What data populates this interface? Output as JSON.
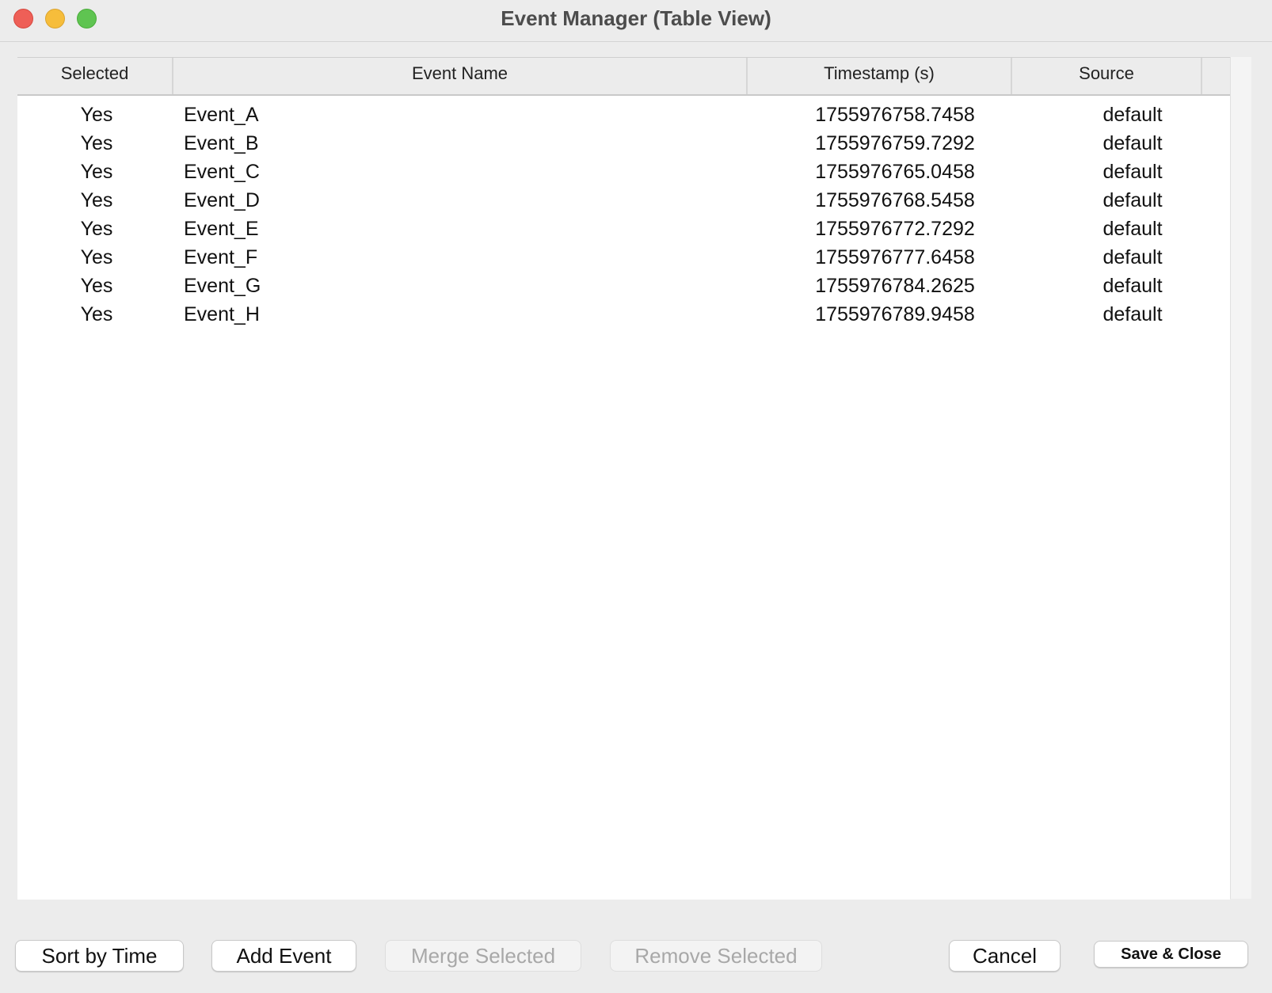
{
  "window": {
    "title": "Event Manager (Table View)"
  },
  "table": {
    "headers": [
      "Selected",
      "Event Name",
      "Timestamp (s)",
      "Source"
    ],
    "rows": [
      {
        "selected": "Yes",
        "name": "Event_A",
        "timestamp": "1755976758.7458",
        "source": "default"
      },
      {
        "selected": "Yes",
        "name": "Event_B",
        "timestamp": "1755976759.7292",
        "source": "default"
      },
      {
        "selected": "Yes",
        "name": "Event_C",
        "timestamp": "1755976765.0458",
        "source": "default"
      },
      {
        "selected": "Yes",
        "name": "Event_D",
        "timestamp": "1755976768.5458",
        "source": "default"
      },
      {
        "selected": "Yes",
        "name": "Event_E",
        "timestamp": "1755976772.7292",
        "source": "default"
      },
      {
        "selected": "Yes",
        "name": "Event_F",
        "timestamp": "1755976777.6458",
        "source": "default"
      },
      {
        "selected": "Yes",
        "name": "Event_G",
        "timestamp": "1755976784.2625",
        "source": "default"
      },
      {
        "selected": "Yes",
        "name": "Event_H",
        "timestamp": "1755976789.9458",
        "source": "default"
      }
    ]
  },
  "buttons": {
    "sort_by_time": "Sort by Time",
    "add_event": "Add Event",
    "merge_selected": "Merge Selected",
    "remove_selected": "Remove Selected",
    "cancel": "Cancel",
    "save_close": "Save & Close"
  },
  "colors": {
    "close": "#ee5f57",
    "minimize": "#f6bd3b",
    "maximize": "#5fc451"
  }
}
